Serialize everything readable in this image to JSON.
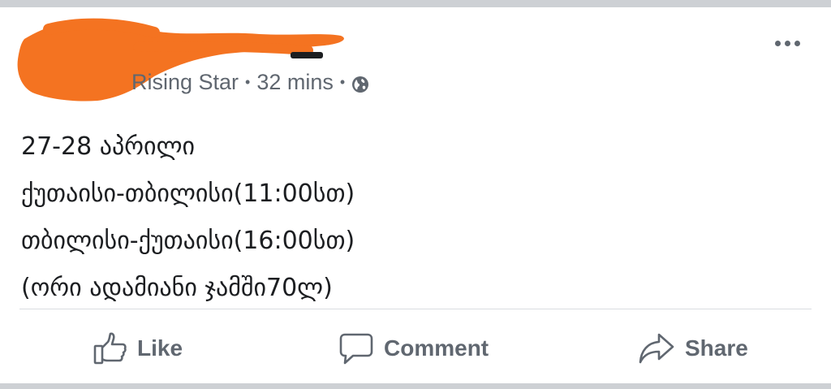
{
  "post": {
    "author_group": "Rising Star",
    "separator": "•",
    "time": "32 mins",
    "privacy_icon": "globe-icon",
    "more_icon": "more-options-icon",
    "lines": [
      "27-28 აპრილი",
      "ქუთაისი-თბილისი(11:00სთ)",
      "თბილისი-ქუთაისი(16:00სთ)",
      "(ორი ადამიანი ჯამში70ლ)"
    ]
  },
  "actions": {
    "like": {
      "label": "Like",
      "icon": "thumbs-up-icon"
    },
    "comment": {
      "label": "Comment",
      "icon": "comment-bubble-icon"
    },
    "share": {
      "label": "Share",
      "icon": "share-arrow-icon"
    }
  },
  "colors": {
    "redaction": "#f47321",
    "muted_text": "#606770",
    "body_text": "#1c1e21",
    "frame": "#cdd0d4"
  }
}
